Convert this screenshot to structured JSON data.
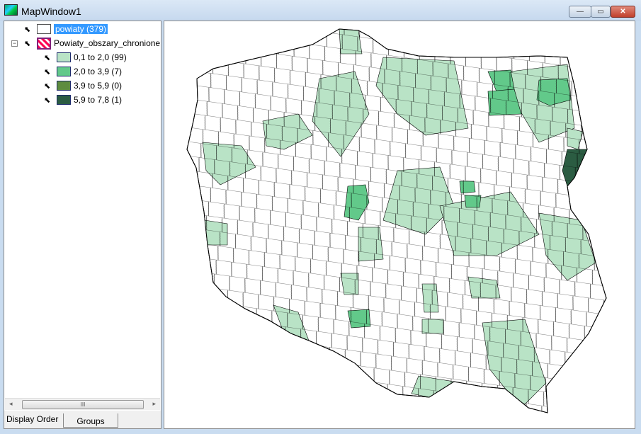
{
  "window": {
    "title": "MapWindow1",
    "minimize": "—",
    "maximize": "▭",
    "close": "✕"
  },
  "legend": {
    "layers": [
      {
        "name": "powiaty (379)",
        "selected": true,
        "color": "#ffffff"
      },
      {
        "name": "Powiaty_obszary_chronione",
        "expanded": true,
        "classes": [
          {
            "label": "0,1 to 2,0 (99)",
            "color": "#b9e3c6"
          },
          {
            "label": "2,0 to 3,9 (7)",
            "color": "#62c98a"
          },
          {
            "label": "3,9 to 5,9 (0)",
            "color": "#5e8c3e"
          },
          {
            "label": "5,9 to 7,8 (1)",
            "color": "#2b5c42"
          }
        ]
      }
    ],
    "scroll_thumb": "III"
  },
  "tabs": [
    {
      "label": "Display Order",
      "active": true
    },
    {
      "label": "Groups",
      "active": false
    }
  ]
}
